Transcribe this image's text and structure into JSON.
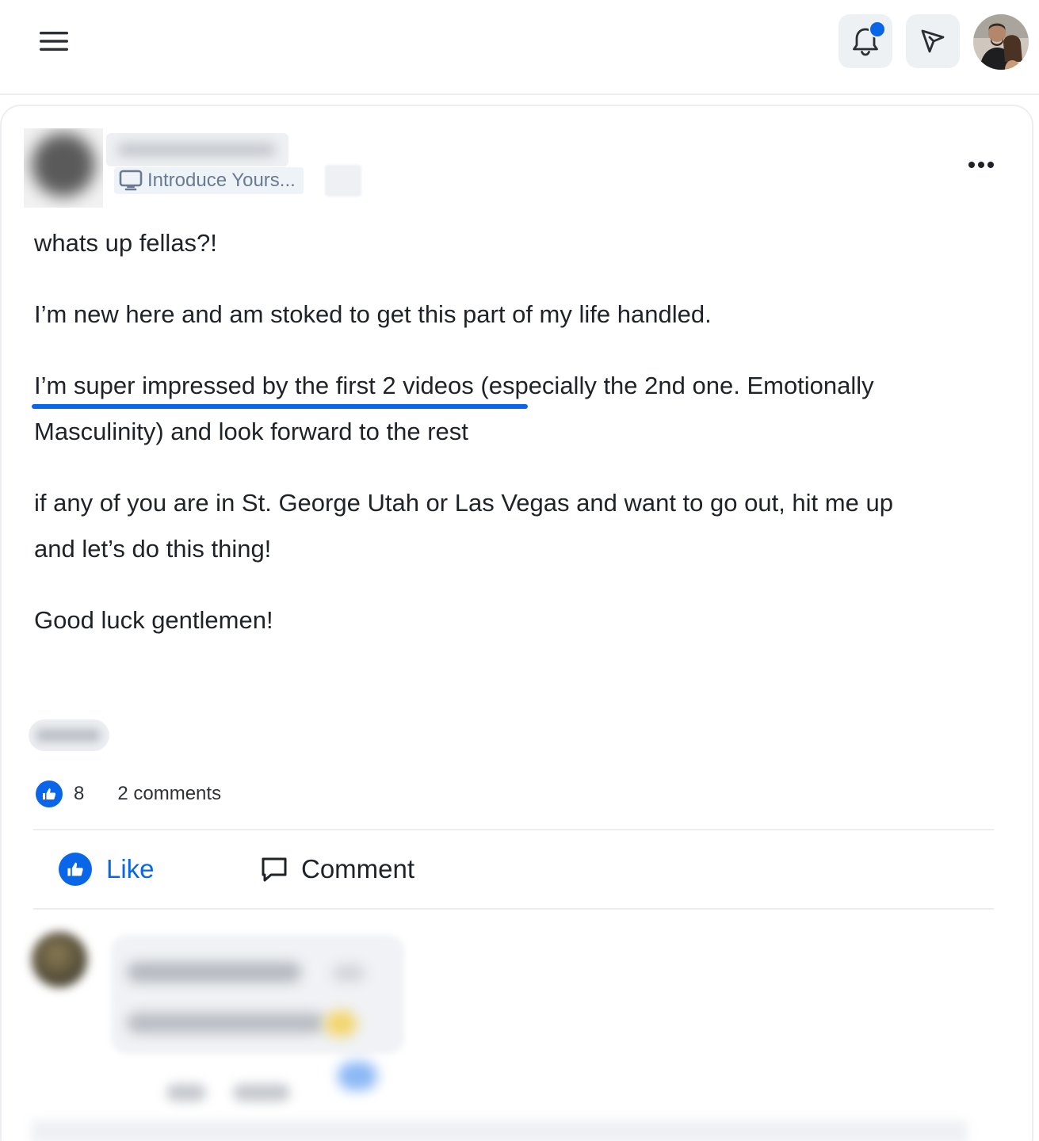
{
  "header": {
    "menu_icon": "hamburger-menu-icon",
    "notifications_icon": "bell-icon",
    "messages_icon": "send-arrow-icon",
    "has_unread_notifications": true,
    "accent_color": "#0a66e8"
  },
  "post": {
    "category": "Introduce Yours...",
    "category_icon": "monitor-icon",
    "more_icon": "more-horizontal-icon",
    "paragraphs": [
      "whats up fellas?!",
      "I’m new here and am stoked to get this part of my life handled.",
      "I’m super impressed by the first 2 videos (especially the 2nd one. Emotionally Masculinity) and look forward to the rest",
      "if any of you are in St. George Utah or Las Vegas and want to go out, hit me up",
      "and let’s do this thing!",
      "Good luck gentlemen!"
    ],
    "likes_count": "8",
    "comments_count": "2 comments",
    "actions": {
      "like_label": "Like",
      "comment_label": "Comment"
    }
  }
}
